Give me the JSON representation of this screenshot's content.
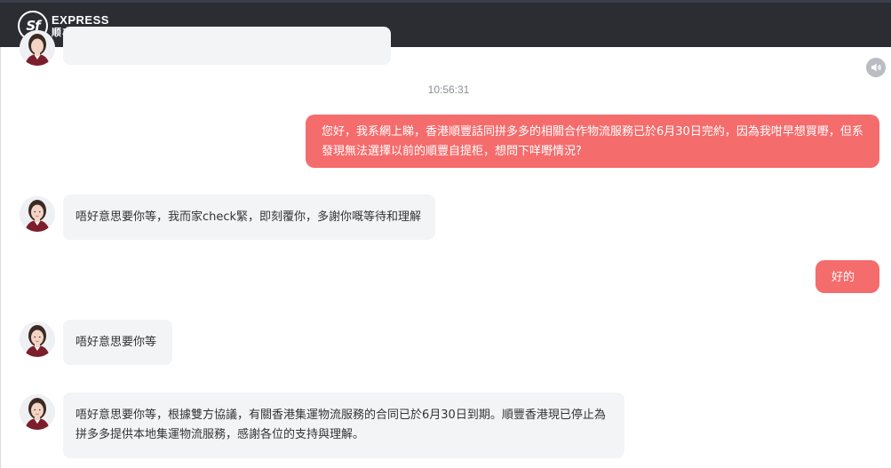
{
  "header": {
    "logo_mark": "Sf",
    "logo_en": "EXPRESS",
    "logo_cn": "顺丰速运"
  },
  "chat": {
    "timestamp": "10:56:31",
    "messages": [
      {
        "from": "user",
        "text": "您好，我系網上睇，香港順豐話同拼多多的相關合作物流服務已於6月30日完約，因為我咁早想買嘢，但系發現無法選擇以前的順豐自提柜，想問下咩嘢情況?"
      },
      {
        "from": "agent",
        "text": "唔好意思要你等，我而家check緊，即刻覆你，多謝你嘅等待和理解"
      },
      {
        "from": "user",
        "text": "好的"
      },
      {
        "from": "agent",
        "text": "唔好意思要你等"
      },
      {
        "from": "agent",
        "text": "唔好意思要你等，根據雙方協議，有關香港集運物流服務的合同已於6月30日到期。順豐香港現已停止為拼多多提供本地集運物流服務，感謝各位的支持與理解。"
      }
    ]
  },
  "colors": {
    "header_bg": "#2b2d33",
    "user_bubble": "#f56c6c",
    "agent_bubble": "#f3f4f6"
  },
  "icons": {
    "speaker": "speaker-muted-icon",
    "avatar": "agent-avatar"
  }
}
